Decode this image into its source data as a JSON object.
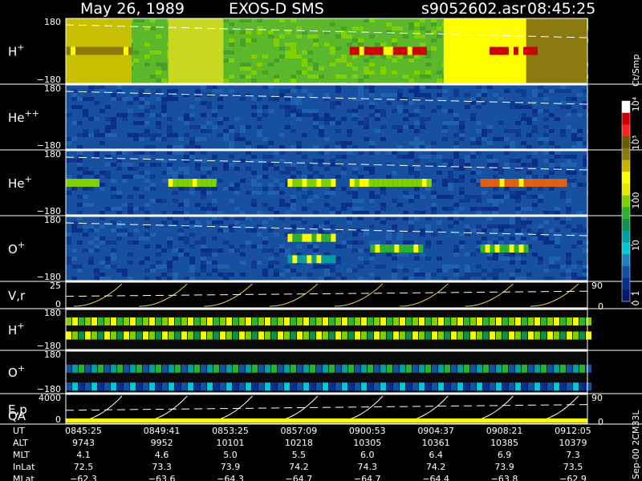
{
  "header": {
    "date": "May 26, 1989",
    "instrument": "EXOS-D SMS",
    "file": "s9052602.asr",
    "time": "08:45:25"
  },
  "colorbar": {
    "label": "Ct/Smp",
    "ticks": [
      "10⁴",
      "10³",
      "100",
      "10",
      "1",
      "0"
    ],
    "colors": [
      "#ffffff",
      "#cc0000",
      "#ff2020",
      "#6e5a00",
      "#8a7a10",
      "#c8b000",
      "#ffff00",
      "#e8e800",
      "#80d000",
      "#30b030",
      "#109050",
      "#00a0a0",
      "#00c8d0",
      "#2080c0",
      "#1850a0",
      "#0a2f8a",
      "#001a6e"
    ]
  },
  "chart_data": [
    {
      "type": "heatmap",
      "name": "panel-h-plus",
      "label": "H",
      "sup": "+",
      "ylim": [
        -180,
        180
      ],
      "ytick_top": "180",
      "ytick_bottom": "−180",
      "background": "#5ab82a",
      "blocks": [
        {
          "t0": "08:45:25",
          "t1": "08:49:00",
          "color": "#c8c000"
        },
        {
          "t0": "08:51:00",
          "t1": "08:54:00",
          "color": "#c8d820"
        },
        {
          "t0": "09:06:00",
          "t1": "09:10:30",
          "color": "#ffff00"
        },
        {
          "t0": "09:10:30",
          "t1": "09:13:50",
          "color": "#8a7a10"
        }
      ],
      "bands": [
        {
          "t0": "08:45:25",
          "t1": "08:49:00",
          "angle": 0,
          "color": "#8a7a10"
        },
        {
          "t0": "09:00:53",
          "t1": "09:05:00",
          "angle": 0,
          "color": "#cc0000"
        },
        {
          "t0": "09:08:30",
          "t1": "09:11:00",
          "angle": 0,
          "color": "#cc0000"
        }
      ]
    },
    {
      "type": "heatmap",
      "name": "panel-he-pp",
      "label": "He",
      "sup": "++",
      "ylim": [
        -180,
        180
      ],
      "ytick_top": "180",
      "ytick_bottom": "−180",
      "background": "#1850a0",
      "blocks": [],
      "bands": []
    },
    {
      "type": "heatmap",
      "name": "panel-he-plus",
      "label": "He",
      "sup": "+",
      "ylim": [
        -180,
        180
      ],
      "ytick_top": "180",
      "ytick_bottom": "−180",
      "background": "#1850a0",
      "blocks": [],
      "bands": [
        {
          "t0": "08:45:25",
          "t1": "08:47:00",
          "angle": 0,
          "color": "#80d000"
        },
        {
          "t0": "08:51:00",
          "t1": "08:53:30",
          "angle": 0,
          "color": "#80d000"
        },
        {
          "t0": "08:57:30",
          "t1": "09:00:00",
          "angle": 0,
          "color": "#80d000"
        },
        {
          "t0": "09:00:53",
          "t1": "09:05:10",
          "angle": 0,
          "color": "#80d000"
        },
        {
          "t0": "09:08:00",
          "t1": "09:12:30",
          "angle": 0,
          "color": "#e06010"
        }
      ]
    },
    {
      "type": "heatmap",
      "name": "panel-o-plus",
      "label": "O",
      "sup": "+",
      "ylim": [
        -180,
        180
      ],
      "ytick_top": "180",
      "ytick_bottom": "−180",
      "background": "#1850a0",
      "blocks": [],
      "bands": [
        {
          "t0": "08:57:30",
          "t1": "09:00:00",
          "angle": 60,
          "color": "#30b030"
        },
        {
          "t0": "08:57:30",
          "t1": "09:00:00",
          "angle": -60,
          "color": "#00a0a0"
        },
        {
          "t0": "09:02:00",
          "t1": "09:04:40",
          "angle": 0,
          "color": "#30b030"
        },
        {
          "t0": "09:08:00",
          "t1": "09:10:30",
          "angle": 0,
          "color": "#30b030"
        }
      ]
    },
    {
      "type": "line",
      "name": "panel-vr",
      "label": "V,r",
      "ytick_top": "25",
      "ytick_bottom": "0",
      "right_tick": "90",
      "right_tick2": "0"
    },
    {
      "type": "heatmap",
      "name": "panel-h-plus-2",
      "label": "H",
      "sup": "+",
      "ylim": [
        -180,
        180
      ],
      "ytick_top": "180",
      "ytick_bottom": "−180",
      "background": "#0a0a0a",
      "rows": [
        {
          "pos": 0.3,
          "colors": [
            "#80d000",
            "#ffff00",
            "#30b030"
          ]
        },
        {
          "pos": 0.65,
          "colors": [
            "#ffff00",
            "#80d000",
            "#109050"
          ]
        }
      ]
    },
    {
      "type": "heatmap",
      "name": "panel-o-plus-2",
      "label": "O",
      "sup": "+",
      "ylim": [
        -180,
        180
      ],
      "ytick_top": "180",
      "ytick_bottom": "−180",
      "background": "#0a0a0a",
      "rows": [
        {
          "pos": 0.42,
          "colors": [
            "#1850a0",
            "#00a0a0",
            "#30b030"
          ]
        },
        {
          "pos": 0.85,
          "colors": [
            "#1850a0",
            "#00c8d0",
            "#0a2f8a"
          ]
        }
      ]
    },
    {
      "type": "line",
      "name": "panel-ep",
      "label": "E,p",
      "label2": "QA",
      "ytick_top": "4000",
      "ytick_bottom": "0",
      "right_tick": "90",
      "right_tick2": "0"
    }
  ],
  "time_axis": {
    "start": "08:45:25",
    "end": "09:13:50",
    "ticks": [
      "08:45:25",
      "08:49:41",
      "08:53:25",
      "08:57:09",
      "09:00:53",
      "09:04:37",
      "09:08:21",
      "09:12:05"
    ]
  },
  "table": {
    "rows": [
      {
        "label": "UT",
        "values": [
          "0845:25",
          "0849:41",
          "0853:25",
          "0857:09",
          "0900:53",
          "0904:37",
          "0908:21",
          "0912:05"
        ]
      },
      {
        "label": "ALT",
        "values": [
          "9743",
          "9952",
          "10101",
          "10218",
          "10305",
          "10361",
          "10385",
          "10379"
        ]
      },
      {
        "label": "MLT",
        "values": [
          "4.1",
          "4.6",
          "5.0",
          "5.5",
          "6.0",
          "6.4",
          "6.9",
          "7.3"
        ]
      },
      {
        "label": "InLat",
        "values": [
          "72.5",
          "73.3",
          "73.9",
          "74.2",
          "74.3",
          "74.2",
          "73.9",
          "73.5"
        ]
      },
      {
        "label": "MLat",
        "values": [
          "−62.3",
          "−63.6",
          "−64.3",
          "−64.7",
          "−64.7",
          "−64.4",
          "−63.8",
          "−62.9"
        ]
      }
    ]
  },
  "footer": {
    "version": "Sep-00 2CM33L"
  }
}
